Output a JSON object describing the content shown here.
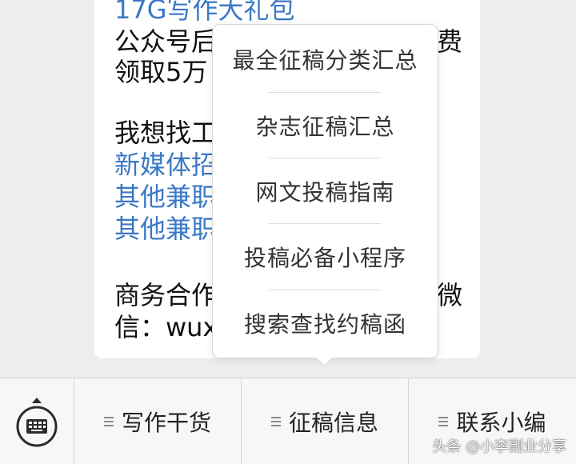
{
  "message": {
    "line_gift": "17G写作大礼包",
    "line_gzh": "公众号后",
    "line_gzh_end": "费",
    "line_lingqu": "领取5万",
    "line_find": "我想找工",
    "link1": "新媒体招",
    "link2": "其他兼职",
    "link3": "其他兼职",
    "line_business": "商务合作",
    "line_business_end": "微",
    "line_wechat": "信：wux"
  },
  "popup_menu": {
    "items": [
      "最全征稿分类汇总",
      "杂志征稿汇总",
      "网文投稿指南",
      "投稿必备小程序",
      "搜索查找约稿函"
    ]
  },
  "bottom_bar": {
    "keyboard_icon": "keyboard-icon",
    "tabs": [
      "写作干货",
      "征稿信息",
      "联系小编"
    ]
  },
  "watermark": "头条 @小李副业分享",
  "colors": {
    "link": "#3b78c6",
    "background": "#ededed",
    "bar": "#f7f7f7"
  }
}
